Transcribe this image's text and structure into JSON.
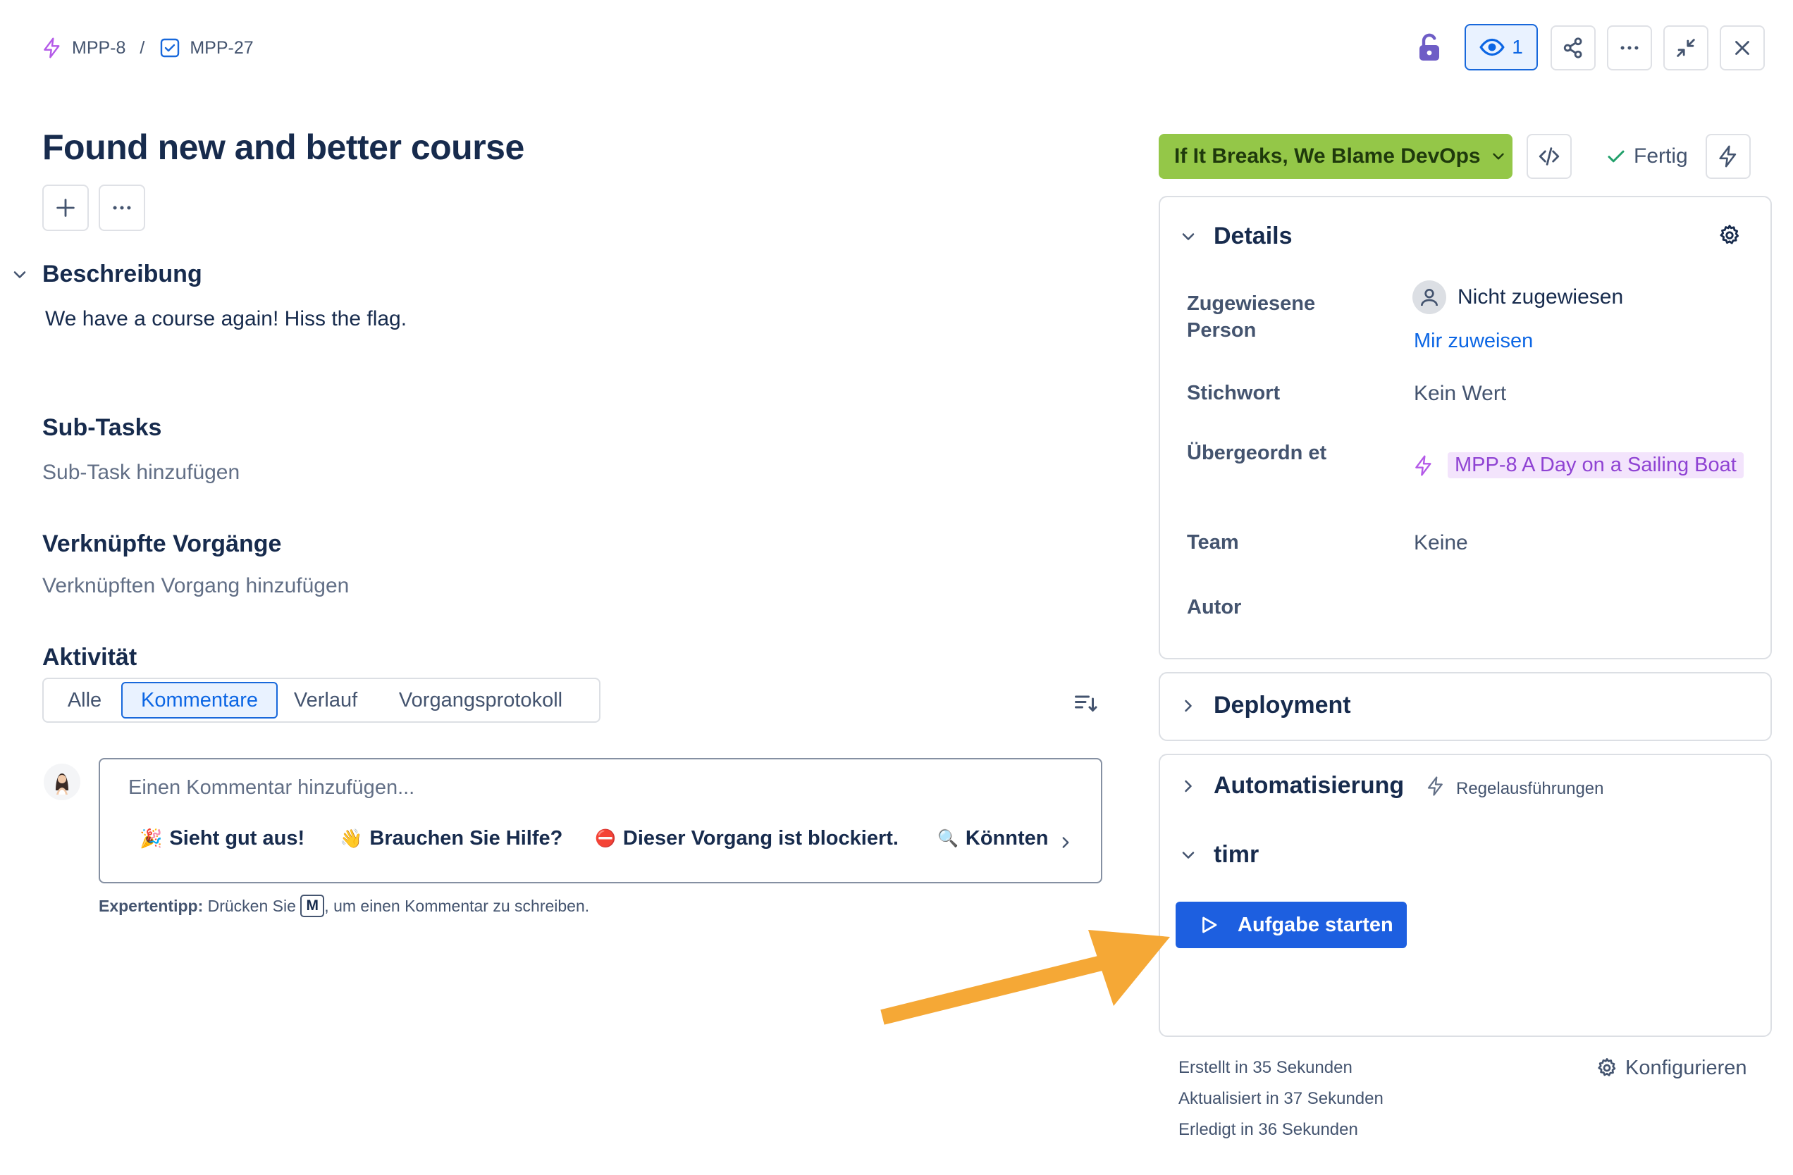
{
  "breadcrumb": {
    "parent_key": "MPP-8",
    "separator": "/",
    "issue_key": "MPP-27"
  },
  "header": {
    "watch_count": "1"
  },
  "issue": {
    "title": "Found new and better course"
  },
  "description": {
    "heading": "Beschreibung",
    "text": "We have a course again! Hiss the flag."
  },
  "subtasks": {
    "heading": "Sub-Tasks",
    "add": "Sub-Task hinzufügen"
  },
  "linked": {
    "heading": "Verknüpfte Vorgänge",
    "add": "Verknüpften Vorgang hinzufügen"
  },
  "activity": {
    "heading": "Aktivität",
    "tabs": [
      "Alle",
      "Kommentare",
      "Verlauf",
      "Vorgangsprotokoll"
    ],
    "active_tab": "Kommentare",
    "comment_placeholder": "Einen Kommentar hinzufügen...",
    "quick_replies": [
      {
        "emoji": "🎉",
        "text": "Sieht gut aus!"
      },
      {
        "emoji": "👋",
        "text": "Brauchen Sie Hilfe?"
      },
      {
        "emoji": "⛔",
        "text": "Dieser Vorgang ist blockiert."
      },
      {
        "emoji": "🔍",
        "text": "Könnten"
      }
    ],
    "tip_bold": "Expertentipp:",
    "tip_pre": "Drücken Sie",
    "tip_key": "M",
    "tip_post": ", um einen Kommentar zu schreiben."
  },
  "status": {
    "label": "If It Breaks, We Blame DevOps",
    "color": "#94c748",
    "done_label": "Fertig"
  },
  "details": {
    "heading": "Details",
    "assignee_label": "Zugewiesene Person",
    "assignee_value": "Nicht zugewiesen",
    "assign_me": "Mir zuweisen",
    "keyword_label": "Stichwort",
    "keyword_value": "Kein Wert",
    "parent_label": "Übergeordn et",
    "parent_value": "MPP-8 A Day on a Sailing Boat",
    "team_label": "Team",
    "team_value": "Keine",
    "author_label": "Autor"
  },
  "deployment": {
    "heading": "Deployment"
  },
  "automation": {
    "heading": "Automatisierung",
    "link": "Regelausführungen"
  },
  "timr": {
    "heading": "timr",
    "start_button": "Aufgabe starten",
    "button_color": "#1d5fe0"
  },
  "footer": {
    "created": "Erstellt in 35 Sekunden",
    "updated": "Aktualisiert in 37 Sekunden",
    "resolved": "Erledigt in 36 Sekunden",
    "configure": "Konfigurieren"
  },
  "colors": {
    "accent": "#0c66e4",
    "arrow": "#f5a836",
    "parent_chip": "#f3e4fc",
    "parent_text": "#8f43d3",
    "lock": "#6e5dc6"
  }
}
